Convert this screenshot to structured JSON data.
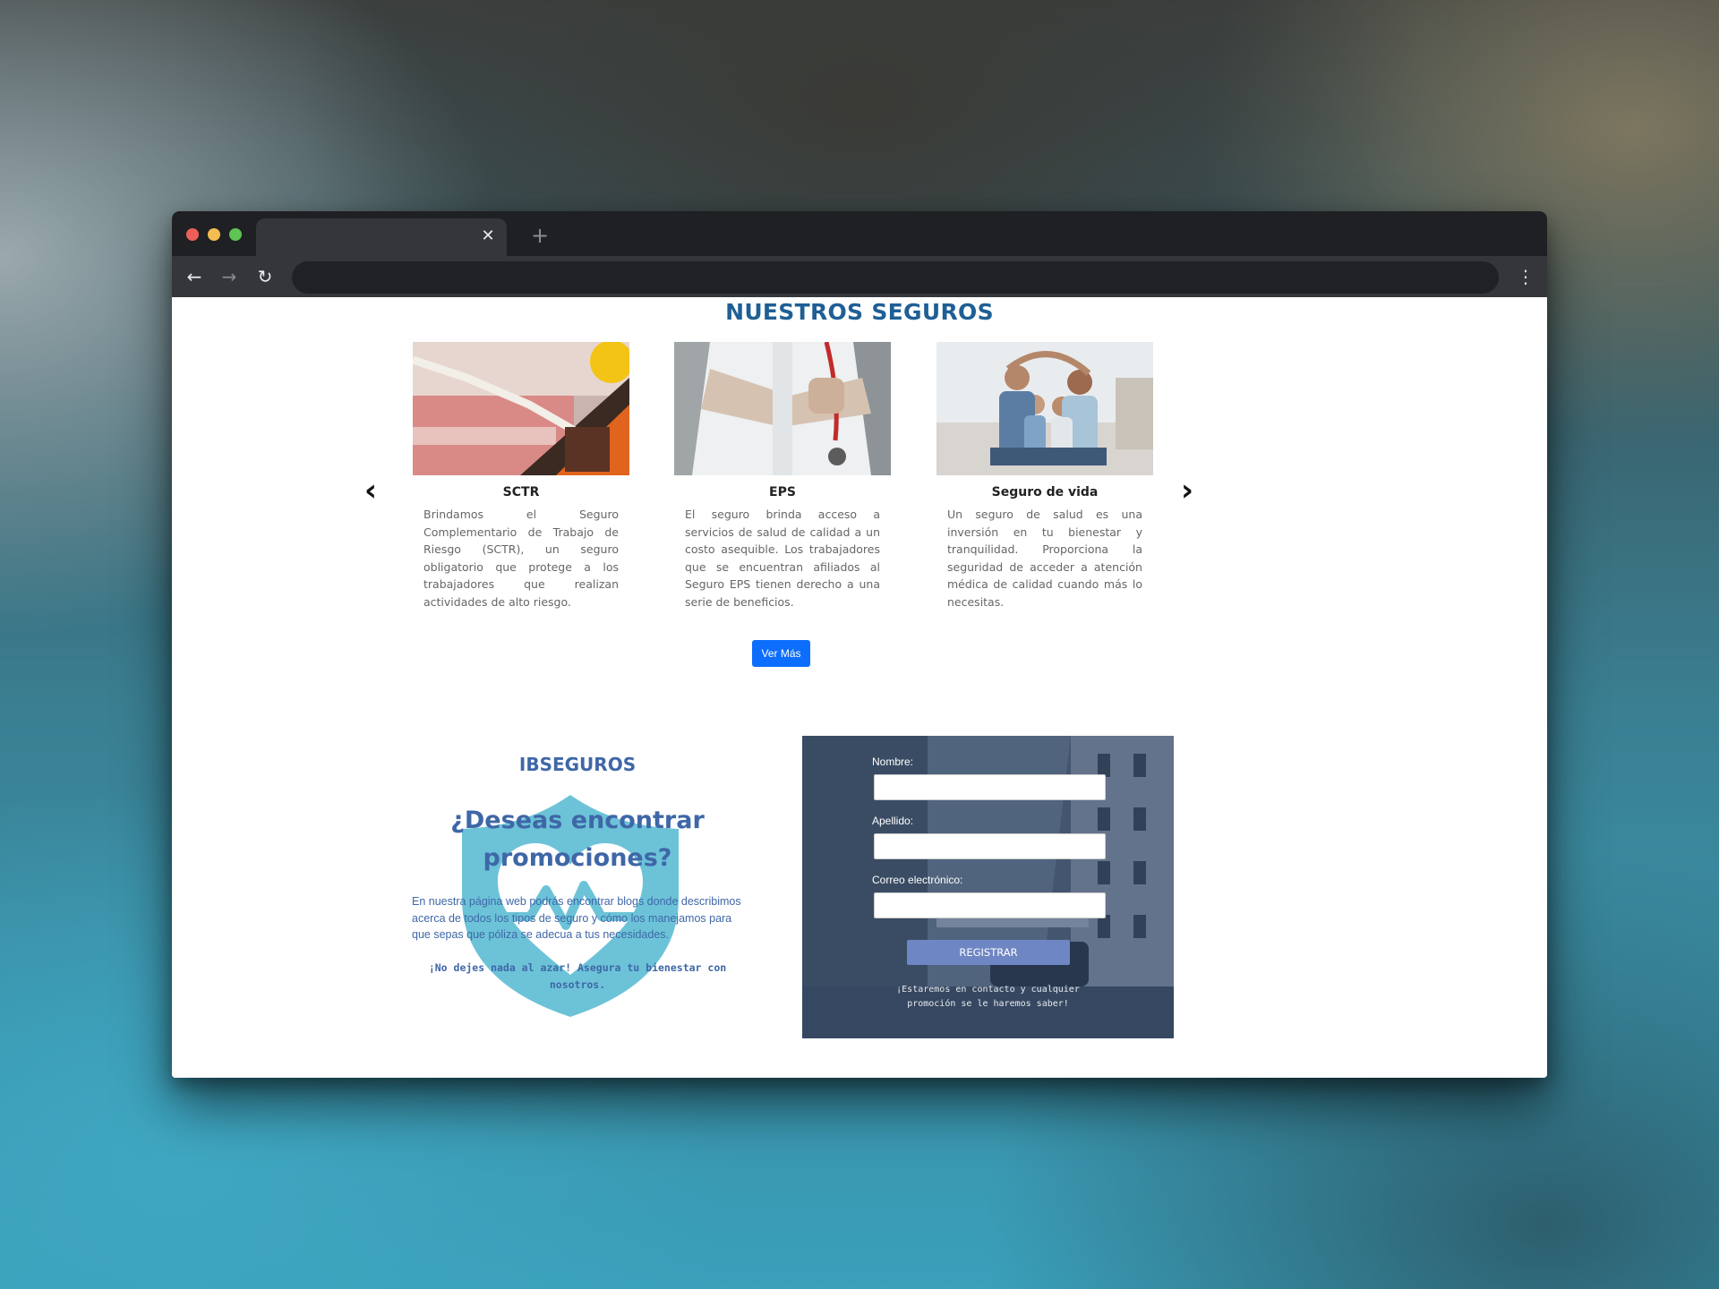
{
  "browser": {
    "tab_close_glyph": "✕",
    "new_tab_glyph": "+",
    "back_glyph": "←",
    "forward_glyph": "→",
    "reload_glyph": "↻",
    "menu_glyph": "⋮"
  },
  "seguros": {
    "title": "NUESTROS SEGUROS",
    "prev_glyph": "‹",
    "next_glyph": "›",
    "cards": [
      {
        "title": "SCTR",
        "text": "Brindamos el Seguro Complementario de Trabajo de Riesgo (SCTR), un seguro obligatorio que protege a los trabajadores que realizan actividades de alto riesgo."
      },
      {
        "title": "EPS",
        "text": "El seguro brinda acceso a servicios de salud de calidad a un costo asequible. Los trabajadores que se encuentran afiliados al Seguro EPS tienen derecho a una serie de beneficios."
      },
      {
        "title": "Seguro de vida",
        "text": "Un seguro de salud es una inversión en tu bienestar y tranquilidad. Proporciona la seguridad de acceder a atención médica de calidad cuando más lo necesitas."
      }
    ],
    "ver_mas": "Ver Más"
  },
  "promo": {
    "brand": "IBSEGUROS",
    "headline": "¿Deseas encontrar promociones?",
    "description": "En nuestra página web podrás encontrar blogs donde describimos acerca de todos los tipos de seguro y cómo los manejamos para que sepas que póliza se adecua a tus necesidades.",
    "tagline": "¡No dejes nada al azar! Asegura tu bienestar con nosotros."
  },
  "form": {
    "nombre_label": "Nombre:",
    "apellido_label": "Apellido:",
    "correo_label": "Correo electrónico:",
    "nombre_value": "",
    "apellido_value": "",
    "correo_value": "",
    "submit_label": "REGISTRAR",
    "note": "¡Estaremos en contacto y cualquier promoción se le haremos saber!"
  },
  "colors": {
    "accent_blue": "#1f5f95",
    "button_blue": "#0d6efd",
    "promo_text": "#3f67a7",
    "shield": "#6cc3d8",
    "register_button": "#6f86c4"
  }
}
